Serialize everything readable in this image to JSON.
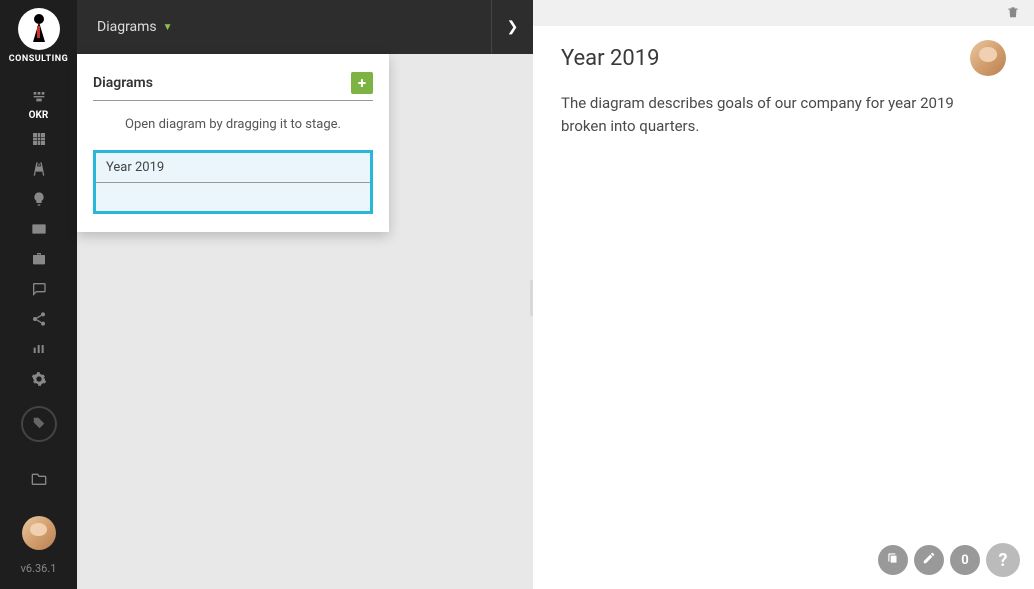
{
  "brand": "CONSULTING",
  "version": "v6.36.1",
  "sidebar": {
    "okr_label": "OKR"
  },
  "toolbar": {
    "diagrams_label": "Diagrams"
  },
  "dropdown": {
    "title": "Diagrams",
    "hint": "Open diagram by dragging it to stage.",
    "items": [
      {
        "title": "Year 2019"
      }
    ]
  },
  "detail": {
    "title": "Year 2019",
    "description": "The diagram describes goals of our company for year 2019 broken into quarters."
  },
  "actions": {
    "count": "0",
    "help": "?"
  }
}
